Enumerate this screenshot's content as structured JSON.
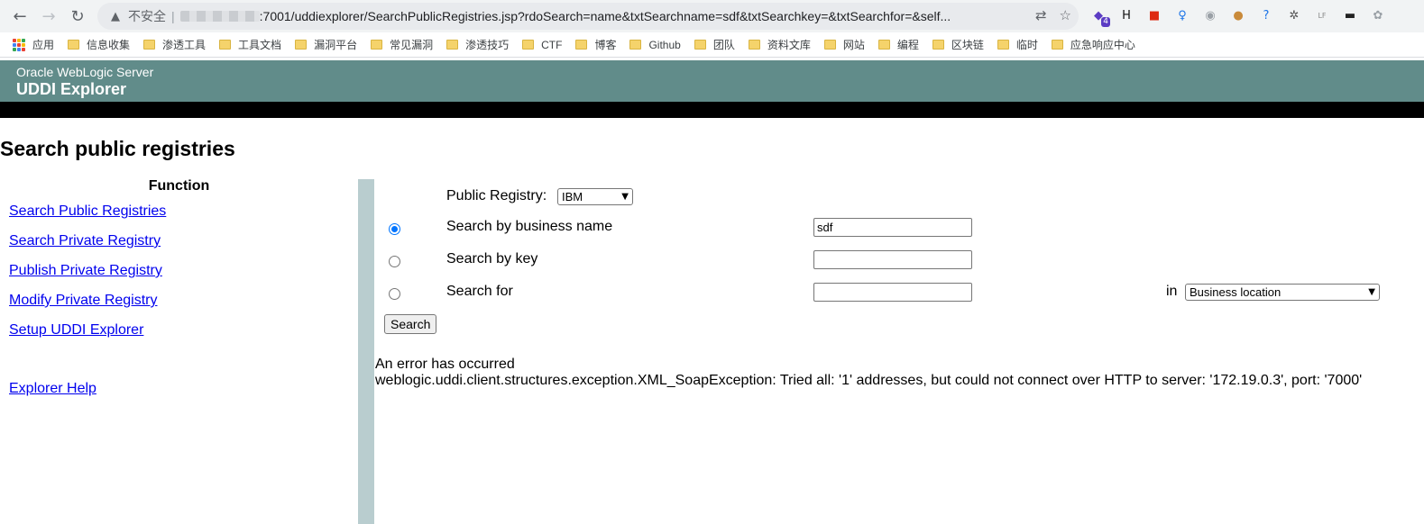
{
  "browser": {
    "back_glyph": "←",
    "forward_glyph": "→",
    "reload_glyph": "↻",
    "warning_glyph": "▲",
    "insecure_label": "不安全",
    "separator": "|",
    "url": ":7001/uddiexplorer/SearchPublicRegistries.jsp?rdoSearch=name&txtSearchname=sdf&txtSearchkey=&txtSearchfor=&self...",
    "translate_glyph": "⇄",
    "star_glyph": "☆",
    "extensions": [
      {
        "icon": "puzzle-icon",
        "glyph": "◆",
        "color": "#5b3cc4",
        "badge": "4"
      },
      {
        "icon": "h-icon",
        "glyph": "H",
        "color": "#111111",
        "badge": ""
      },
      {
        "icon": "flag-icon",
        "glyph": "■",
        "color": "#de2910",
        "badge": ""
      },
      {
        "icon": "pin-icon",
        "glyph": "♀",
        "color": "#1a73e8",
        "badge": ""
      },
      {
        "icon": "circle-icon",
        "glyph": "◉",
        "color": "#9aa0a6",
        "badge": ""
      },
      {
        "icon": "cookie-icon",
        "glyph": "●",
        "color": "#c98a3a",
        "badge": ""
      },
      {
        "icon": "help-icon",
        "glyph": "?",
        "color": "#1a73e8",
        "badge": ""
      },
      {
        "icon": "gear-icon",
        "glyph": "✲",
        "color": "#555555",
        "badge": ""
      },
      {
        "icon": "lf-icon",
        "glyph": "LF",
        "color": "#888888",
        "badge": ""
      },
      {
        "icon": "mask-icon",
        "glyph": "▬",
        "color": "#222222",
        "badge": ""
      },
      {
        "icon": "shield-icon",
        "glyph": "✿",
        "color": "#9aa0a6",
        "badge": ""
      }
    ]
  },
  "bookmarks": [
    {
      "label": "应用",
      "type": "apps"
    },
    {
      "label": "信息收集",
      "type": "folder"
    },
    {
      "label": "渗透工具",
      "type": "folder"
    },
    {
      "label": "工具文档",
      "type": "folder"
    },
    {
      "label": "漏洞平台",
      "type": "folder"
    },
    {
      "label": "常见漏洞",
      "type": "folder"
    },
    {
      "label": "渗透技巧",
      "type": "folder"
    },
    {
      "label": "CTF",
      "type": "folder"
    },
    {
      "label": "博客",
      "type": "folder"
    },
    {
      "label": "Github",
      "type": "folder"
    },
    {
      "label": "团队",
      "type": "folder"
    },
    {
      "label": "资料文库",
      "type": "folder"
    },
    {
      "label": "网站",
      "type": "folder"
    },
    {
      "label": "编程",
      "type": "folder"
    },
    {
      "label": "区块链",
      "type": "folder"
    },
    {
      "label": "临时",
      "type": "folder"
    },
    {
      "label": "应急响应中心",
      "type": "folder"
    }
  ],
  "header": {
    "subtitle": "Oracle WebLogic Server",
    "title": "UDDI Explorer",
    "bg_color": "#618c8a"
  },
  "page_title": "Search public registries",
  "nav": {
    "heading": "Function",
    "links": [
      "Search Public Registries",
      "Search Private Registry",
      "Publish Private Registry",
      "Modify Private Registry",
      "Setup UDDI Explorer"
    ],
    "help": "Explorer Help"
  },
  "form": {
    "registry_label": "Public Registry:",
    "registry_value": "IBM",
    "options": [
      {
        "label": "Search by business name",
        "checked": true,
        "value": "sdf"
      },
      {
        "label": "Search by key",
        "checked": false,
        "value": ""
      },
      {
        "label": "Search for",
        "checked": false,
        "value": ""
      }
    ],
    "in_label": "in",
    "in_value": "Business location",
    "search_button": "Search"
  },
  "error": {
    "title": "An error has occurred",
    "message": "weblogic.uddi.client.structures.exception.XML_SoapException: Tried all: '1' addresses, but could not connect over HTTP to server: '172.19.0.3', port: '7000'"
  },
  "dropdown_glyph": "▼"
}
